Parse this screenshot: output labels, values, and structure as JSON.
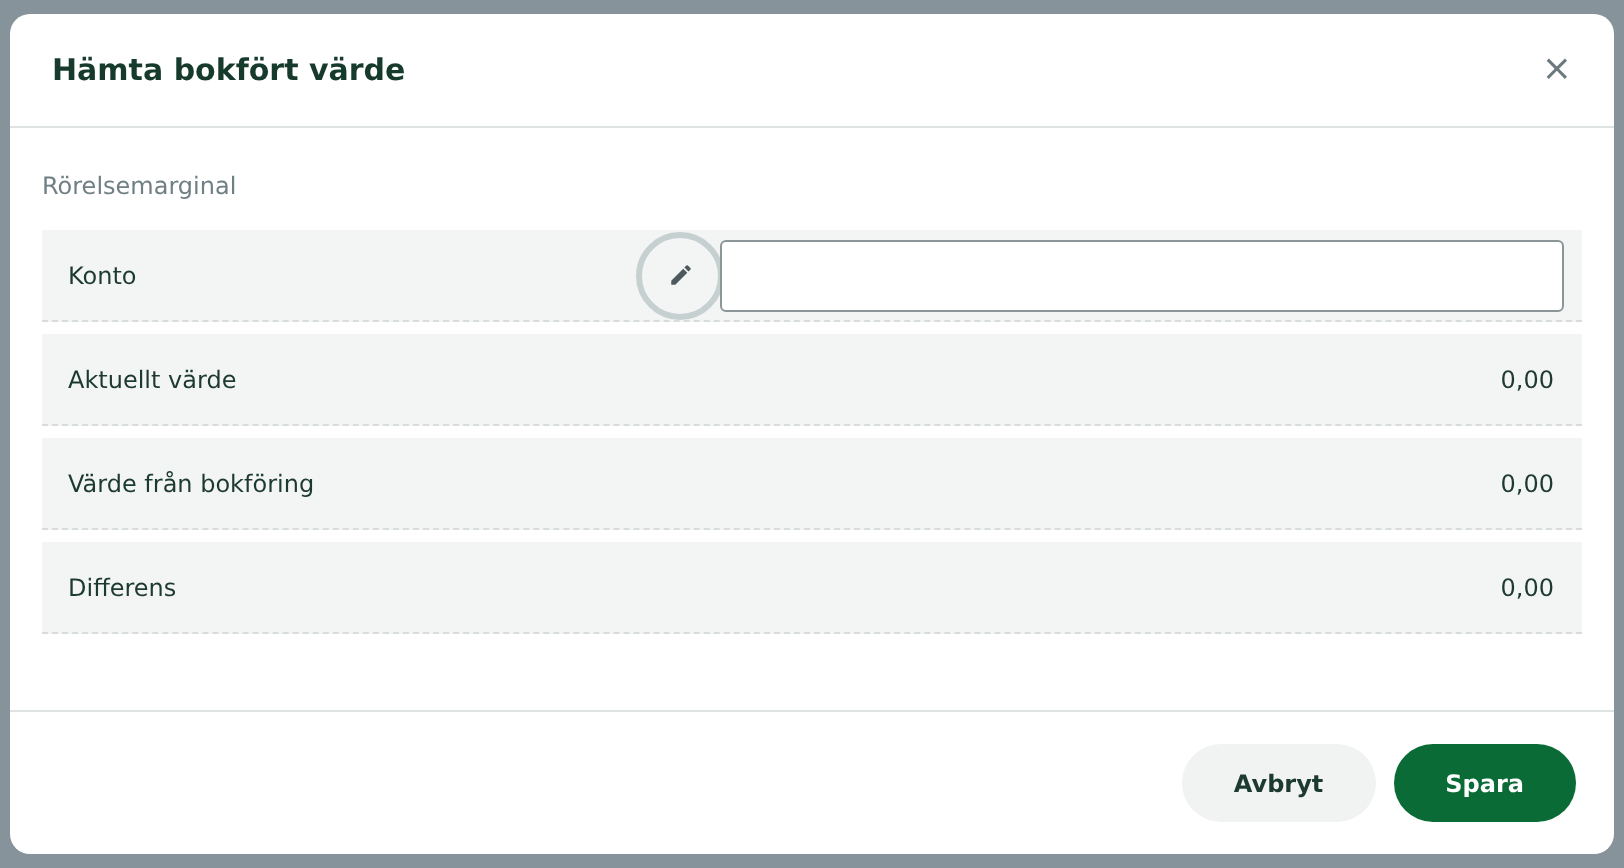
{
  "dialog": {
    "title": "Hämta bokfört värde",
    "close": "×",
    "section": "Rörelsemarginal",
    "rows": [
      {
        "kind": "input",
        "label": "Konto"
      },
      {
        "kind": "value",
        "label": "Aktuellt värde",
        "value": "0,00"
      },
      {
        "kind": "value",
        "label": "Värde från bokföring",
        "value": "0,00"
      },
      {
        "kind": "value",
        "label": "Differens",
        "value": "0,00"
      }
    ],
    "buttons": [
      {
        "kind": "secondary",
        "label": "Avbryt"
      },
      {
        "kind": "primary",
        "label": "Spara"
      }
    ]
  }
}
